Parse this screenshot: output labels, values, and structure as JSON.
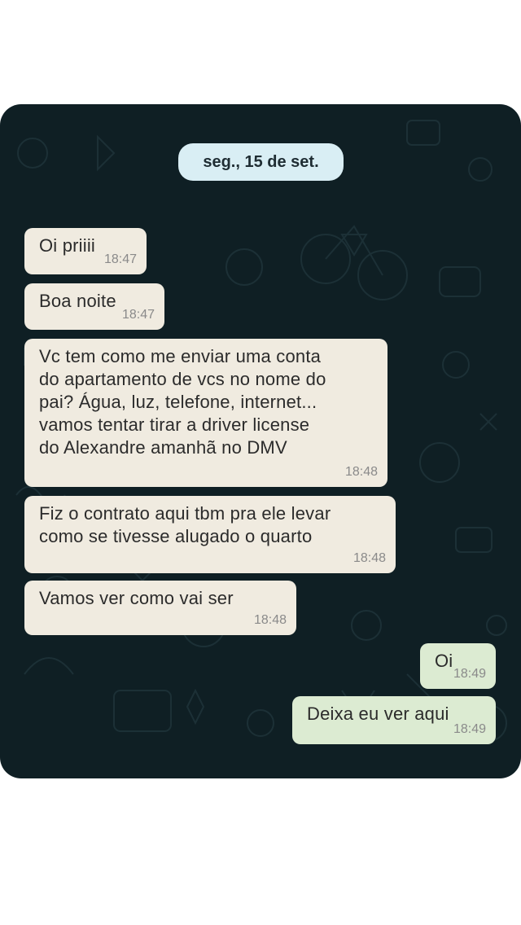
{
  "date_separator": "seg., 15 de set.",
  "messages": [
    {
      "direction": "incoming",
      "text": "Oi priiii",
      "time": "18:47"
    },
    {
      "direction": "incoming",
      "text": "Boa noite",
      "time": "18:47"
    },
    {
      "direction": "incoming",
      "text": "Vc tem como me enviar uma conta\ndo apartamento de vcs no nome do\npai? Água, luz, telefone, internet...\nvamos tentar tirar a driver license\ndo Alexandre amanhã no DMV",
      "time": "18:48"
    },
    {
      "direction": "incoming",
      "text": "Fiz o contrato  aqui tbm pra ele levar\ncomo se tivesse alugado o quarto",
      "time": "18:48"
    },
    {
      "direction": "incoming",
      "text": "Vamos ver como vai ser",
      "time": "18:48"
    },
    {
      "direction": "outgoing",
      "text": "Oi",
      "time": "18:49"
    },
    {
      "direction": "outgoing",
      "text": "Deixa eu ver aqui",
      "time": "18:49"
    }
  ],
  "colors": {
    "wallpaper": "#0f1f24",
    "incoming_bubble": "#f0ebe0",
    "outgoing_bubble": "#dcebd2",
    "date_pill": "#d9eef4"
  }
}
